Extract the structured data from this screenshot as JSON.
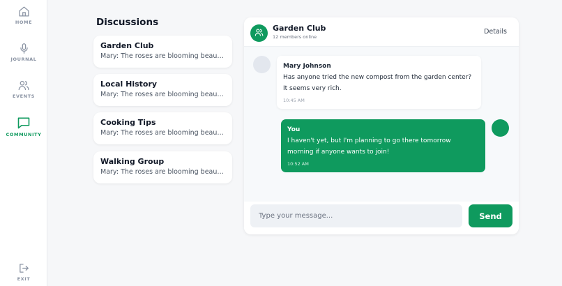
{
  "nav": {
    "items": [
      {
        "label": "HOME",
        "icon": "home-icon"
      },
      {
        "label": "JOURNAL",
        "icon": "microphone-icon"
      },
      {
        "label": "EVENTS",
        "icon": "people-icon"
      },
      {
        "label": "COMMUNITY",
        "icon": "chat-bubble-icon",
        "active": true
      }
    ],
    "exit": {
      "label": "EXIT",
      "icon": "exit-icon"
    }
  },
  "discussions": {
    "title": "Discussions",
    "items": [
      {
        "name": "Garden Club",
        "preview": "Mary: The roses are blooming beautifully this year!"
      },
      {
        "name": "Local History",
        "preview": "Mary: The roses are blooming beautifully this year!"
      },
      {
        "name": "Cooking Tips",
        "preview": "Mary: The roses are blooming beautifully this year!"
      },
      {
        "name": "Walking Group",
        "preview": "Mary: The roses are blooming beautifully this year!"
      }
    ]
  },
  "chat": {
    "name": "Garden Club",
    "subtitle": "12 members online",
    "details_label": "Details",
    "messages": [
      {
        "sender": "Mary Johnson",
        "text": "Has anyone tried the new compost from the garden center? It seems very rich.",
        "time": "10:45 AM",
        "direction": "incoming"
      },
      {
        "sender": "You",
        "text": "I haven't yet, but I'm planning to go there tomorrow morning if anyone wants to join!",
        "time": "10:52 AM",
        "direction": "outgoing"
      }
    ],
    "input": {
      "placeholder": "Type your message...",
      "value": ""
    },
    "send_label": "Send"
  },
  "colors": {
    "accent": "#0f9a5e",
    "incoming_avatar": "#e3e7ee",
    "nav_inactive": "#8a93a3"
  }
}
